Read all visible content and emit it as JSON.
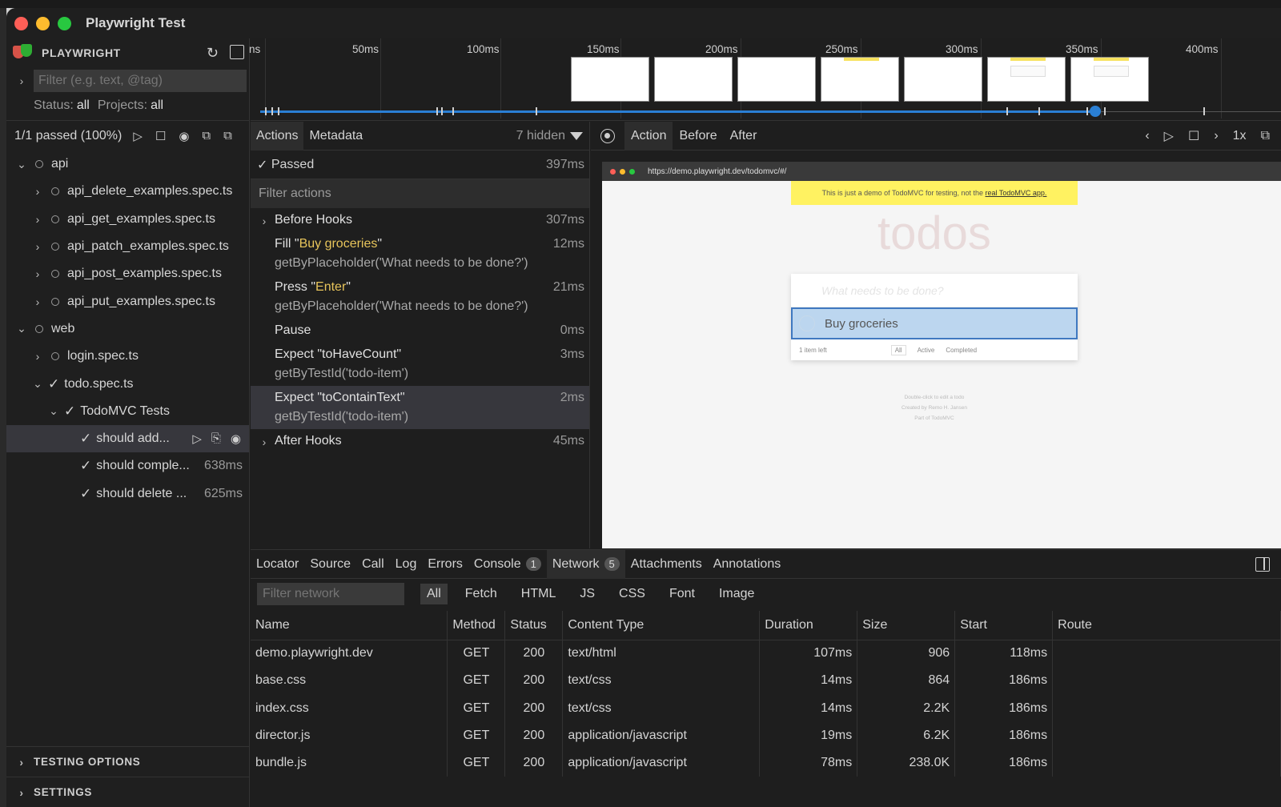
{
  "window": {
    "title": "Playwright Test"
  },
  "sidebar": {
    "brand": "PLAYWRIGHT",
    "filter_placeholder": "Filter (e.g. text, @tag)",
    "status_label": "Status:",
    "status_value": "all",
    "projects_label": "Projects:",
    "projects_value": "all",
    "summary": "1/1 passed (100%)",
    "tree": [
      {
        "label": "api",
        "indent": 0,
        "marker": "circle",
        "chevron": "down"
      },
      {
        "label": "api_delete_examples.spec.ts",
        "indent": 1,
        "marker": "circle",
        "chevron": "right"
      },
      {
        "label": "api_get_examples.spec.ts",
        "indent": 1,
        "marker": "circle",
        "chevron": "right"
      },
      {
        "label": "api_patch_examples.spec.ts",
        "indent": 1,
        "marker": "circle",
        "chevron": "right"
      },
      {
        "label": "api_post_examples.spec.ts",
        "indent": 1,
        "marker": "circle",
        "chevron": "right"
      },
      {
        "label": "api_put_examples.spec.ts",
        "indent": 1,
        "marker": "circle",
        "chevron": "right"
      },
      {
        "label": "web",
        "indent": 0,
        "marker": "circle",
        "chevron": "down"
      },
      {
        "label": "login.spec.ts",
        "indent": 1,
        "marker": "circle",
        "chevron": "right"
      },
      {
        "label": "todo.spec.ts",
        "indent": 1,
        "marker": "check",
        "chevron": "down"
      },
      {
        "label": "TodoMVC Tests",
        "indent": 2,
        "marker": "check",
        "chevron": "down"
      },
      {
        "label": "should add...",
        "indent": 3,
        "marker": "check",
        "chevron": "",
        "selected": true
      },
      {
        "label": "should comple...",
        "indent": 3,
        "marker": "check",
        "chevron": "",
        "time": "638ms"
      },
      {
        "label": "should delete ...",
        "indent": 3,
        "marker": "check",
        "chevron": "",
        "time": "625ms"
      }
    ],
    "sections": [
      "TESTING OPTIONS",
      "SETTINGS"
    ]
  },
  "timeline": {
    "ticks": [
      "ns",
      "50ms",
      "100ms",
      "150ms",
      "200ms",
      "250ms",
      "300ms",
      "350ms",
      "400ms"
    ]
  },
  "actions": {
    "tabs": [
      "Actions",
      "Metadata"
    ],
    "hidden": "7 hidden",
    "passed_label": "Passed",
    "passed_time": "397ms",
    "filter_placeholder": "Filter actions",
    "items": [
      {
        "pre": "Before Hooks",
        "hl": "",
        "post": "",
        "sub": "",
        "time": "307ms",
        "chevron": true
      },
      {
        "pre": "Fill \"",
        "hl": "Buy groceries",
        "post": "\"",
        "sub": "getByPlaceholder('What needs to be done?')",
        "time": "12ms"
      },
      {
        "pre": "Press \"",
        "hl": "Enter",
        "post": "\"",
        "sub": "getByPlaceholder('What needs to be done?')",
        "time": "21ms"
      },
      {
        "pre": "Pause",
        "hl": "",
        "post": "",
        "sub": "",
        "time": "0ms"
      },
      {
        "pre": "Expect \"toHaveCount\"",
        "hl": "",
        "post": "",
        "sub": "getByTestId('todo-item')",
        "time": "3ms"
      },
      {
        "pre": "Expect \"toContainText\"",
        "hl": "",
        "post": "",
        "sub": "getByTestId('todo-item')",
        "time": "2ms",
        "selected": true
      },
      {
        "pre": "After Hooks",
        "hl": "",
        "post": "",
        "sub": "",
        "time": "45ms",
        "chevron": true
      }
    ]
  },
  "preview": {
    "tabs": [
      "Action",
      "Before",
      "After"
    ],
    "speed": "1x",
    "url": "https://demo.playwright.dev/todomvc/#/",
    "banner_text": "This is just a demo of TodoMVC for testing, not the",
    "banner_link": "real TodoMVC app.",
    "heading": "todos",
    "input_placeholder": "What needs to be done?",
    "todo_item": "Buy groceries",
    "footer_count": "1 item left",
    "footer_filters": [
      "All",
      "Active",
      "Completed"
    ],
    "info_lines": [
      "Double-click to edit a todo",
      "Created by Remo H. Jansen",
      "Part of TodoMVC"
    ]
  },
  "bottom": {
    "tabs": [
      {
        "label": "Locator"
      },
      {
        "label": "Source"
      },
      {
        "label": "Call"
      },
      {
        "label": "Log"
      },
      {
        "label": "Errors"
      },
      {
        "label": "Console",
        "badge": "1"
      },
      {
        "label": "Network",
        "badge": "5",
        "active": true
      },
      {
        "label": "Attachments"
      },
      {
        "label": "Annotations"
      }
    ],
    "filter_placeholder": "Filter network",
    "types": [
      "All",
      "Fetch",
      "HTML",
      "JS",
      "CSS",
      "Font",
      "Image"
    ],
    "columns": [
      "Name",
      "Method",
      "Status",
      "Content Type",
      "Duration",
      "Size",
      "Start",
      "Route"
    ],
    "rows": [
      [
        "demo.playwright.dev",
        "GET",
        "200",
        "text/html",
        "107ms",
        "906",
        "118ms",
        ""
      ],
      [
        "base.css",
        "GET",
        "200",
        "text/css",
        "14ms",
        "864",
        "186ms",
        ""
      ],
      [
        "index.css",
        "GET",
        "200",
        "text/css",
        "14ms",
        "2.2K",
        "186ms",
        ""
      ],
      [
        "director.js",
        "GET",
        "200",
        "application/javascript",
        "19ms",
        "6.2K",
        "186ms",
        ""
      ],
      [
        "bundle.js",
        "GET",
        "200",
        "application/javascript",
        "78ms",
        "238.0K",
        "186ms",
        ""
      ]
    ]
  }
}
